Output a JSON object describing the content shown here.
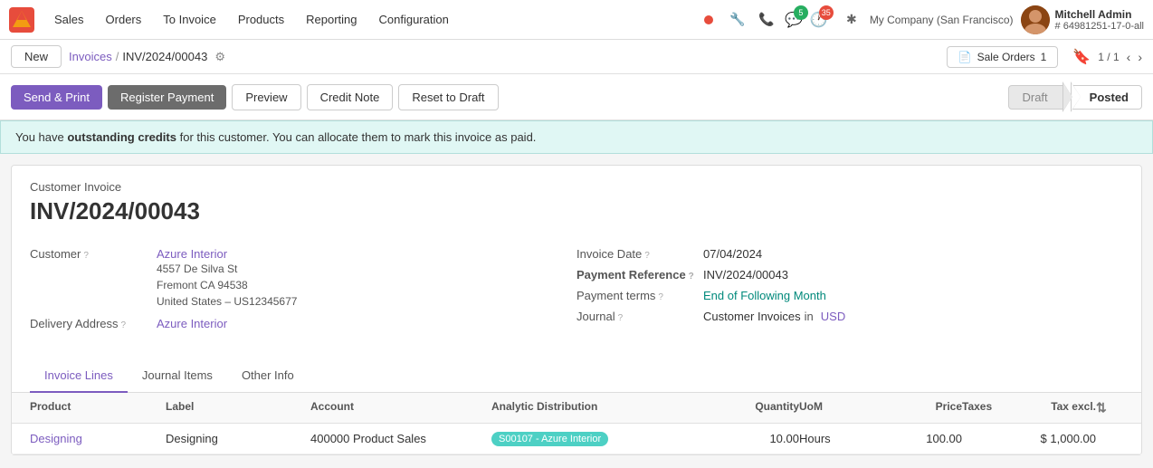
{
  "app": {
    "logo_text": "🟠",
    "nav_items": [
      "Sales",
      "Orders",
      "To Invoice",
      "Products",
      "Reporting",
      "Configuration"
    ]
  },
  "topnav": {
    "notifications": [
      {
        "icon": "●",
        "color": "#e74c3c"
      },
      {
        "icon": "🔧",
        "color": "#555"
      },
      {
        "icon": "📞",
        "color": "#555"
      }
    ],
    "badge1_count": "5",
    "badge2_count": "35",
    "company": "My Company (San Francisco)",
    "user_name": "Mitchell Admin",
    "user_id": "# 64981251-17-0-all"
  },
  "breadcrumb": {
    "new_label": "New",
    "parent": "Invoices",
    "current": "INV/2024/00043",
    "sale_orders_label": "Sale Orders",
    "sale_orders_count": "1",
    "page_current": "1",
    "page_total": "1"
  },
  "actions": {
    "send_print": "Send & Print",
    "register_payment": "Register Payment",
    "preview": "Preview",
    "credit_note": "Credit Note",
    "reset_to_draft": "Reset to Draft"
  },
  "status": {
    "draft": "Draft",
    "posted": "Posted"
  },
  "alert": {
    "prefix": "You have ",
    "bold_text": "outstanding credits",
    "suffix": " for this customer. You can allocate them to mark this invoice as paid."
  },
  "invoice": {
    "type": "Customer Invoice",
    "number": "INV/2024/00043",
    "customer_label": "Customer",
    "customer_name": "Azure Interior",
    "customer_address_line1": "4557 De Silva St",
    "customer_address_line2": "Fremont CA 94538",
    "customer_address_line3": "United States – US12345677",
    "delivery_label": "Delivery Address",
    "delivery_name": "Azure Interior",
    "invoice_date_label": "Invoice Date",
    "invoice_date": "07/04/2024",
    "payment_ref_label": "Payment Reference",
    "payment_ref": "INV/2024/00043",
    "payment_terms_label": "Payment terms",
    "payment_terms": "End of Following Month",
    "journal_label": "Journal",
    "journal_value": "Customer Invoices",
    "journal_in": "in",
    "journal_currency": "USD"
  },
  "tabs": [
    {
      "label": "Invoice Lines",
      "active": true
    },
    {
      "label": "Journal Items",
      "active": false
    },
    {
      "label": "Other Info",
      "active": false
    }
  ],
  "table": {
    "headers": [
      "Product",
      "Label",
      "Account",
      "Analytic Distribution",
      "Quantity",
      "UoM",
      "Price",
      "Taxes",
      "Tax excl.",
      ""
    ],
    "rows": [
      {
        "product": "Designing",
        "label": "Designing",
        "account": "400000 Product Sales",
        "analytic": "S00107 - Azure Interior",
        "quantity": "10.00",
        "uom": "Hours",
        "price": "100.00",
        "taxes": "",
        "tax_excl": "$ 1,000.00"
      }
    ]
  }
}
